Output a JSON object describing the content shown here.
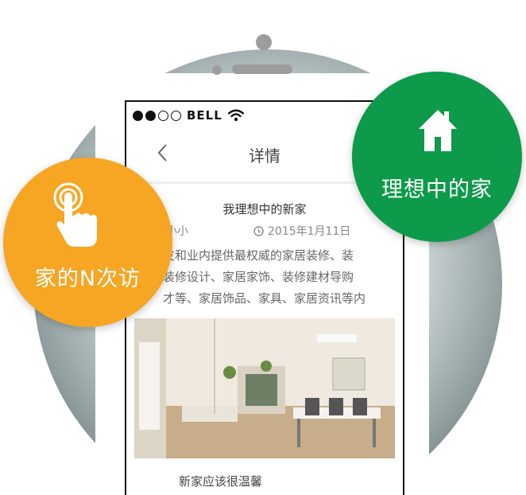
{
  "statusbar": {
    "carrier": "BELL"
  },
  "navbar": {
    "title": "详情"
  },
  "article": {
    "title": "我理想中的新家",
    "author": "小小",
    "date": "2015年1月11日",
    "lines": [
      "友和业内提供最权威的家居装修、装",
      "装修设计、家居家饰、装修建材导购",
      "才等、家居饰品、家具、家居资讯等内"
    ],
    "caption": "新家应该很温馨"
  },
  "badges": {
    "visits": {
      "label": "家的N次访",
      "color": "#f6a623"
    },
    "ideal_home": {
      "label": "理想中的家",
      "color": "#0d9a4a"
    }
  }
}
